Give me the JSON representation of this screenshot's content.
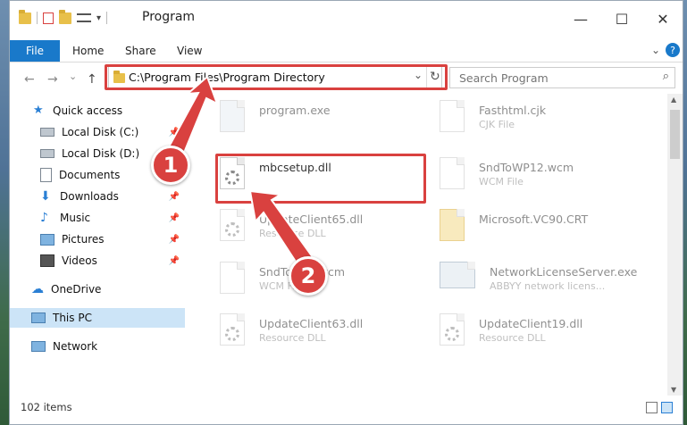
{
  "window": {
    "title": "Program",
    "minimize": "—",
    "maximize": "☐",
    "close": "✕"
  },
  "ribbon": {
    "file": "File",
    "home": "Home",
    "share": "Share",
    "view": "View",
    "help": "?"
  },
  "address": {
    "path": "C:\\Program Files\\Program Directory",
    "dropdown": "⌄",
    "refresh": "↻"
  },
  "search": {
    "placeholder": "Search Program"
  },
  "nav_buttons": {
    "back": "←",
    "forward": "→",
    "recent": "⌄",
    "up": "↑"
  },
  "sidebar": {
    "items": [
      {
        "label": "Quick access"
      },
      {
        "label": "Local Disk (C:)"
      },
      {
        "label": "Local Disk (D:)"
      },
      {
        "label": "Documents"
      },
      {
        "label": "Downloads"
      },
      {
        "label": "Music"
      },
      {
        "label": "Pictures"
      },
      {
        "label": "Videos"
      },
      {
        "label": "OneDrive"
      },
      {
        "label": "This PC"
      },
      {
        "label": "Network"
      }
    ]
  },
  "files": [
    {
      "name": "program.exe",
      "desc": ""
    },
    {
      "name": "Fasthtml.cjk",
      "desc": "CJK File"
    },
    {
      "name": "mbcsetup.dll",
      "desc": ""
    },
    {
      "name": "SndToWP12.wcm",
      "desc": "WCM File"
    },
    {
      "name": "UpdateClient65.dll",
      "desc": "Resource DLL"
    },
    {
      "name": "Microsoft.VC90.CRT",
      "desc": ""
    },
    {
      "name": "SndToWP...wcm",
      "desc": "WCM File"
    },
    {
      "name": "NetworkLicenseServer.exe",
      "desc": "ABBYY network licens..."
    },
    {
      "name": "UpdateClient63.dll",
      "desc": "Resource DLL"
    },
    {
      "name": "UpdateClient19.dll",
      "desc": "Resource DLL"
    }
  ],
  "status": {
    "count": "102 items"
  },
  "annotations": {
    "step1": "1",
    "step2": "2"
  },
  "colors": {
    "accent": "#1979ca",
    "highlight": "#d9413f",
    "selected": "#cce4f7"
  }
}
